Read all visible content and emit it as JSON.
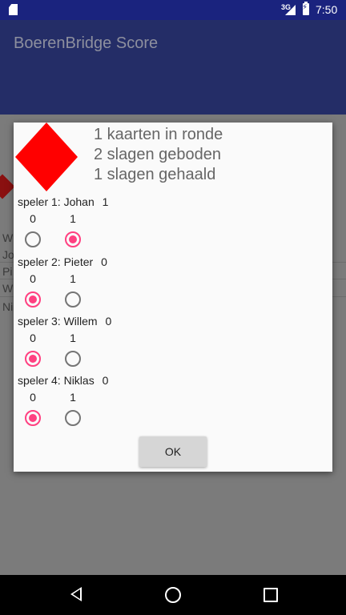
{
  "status_bar": {
    "network": "3G",
    "time": "7:50"
  },
  "app_bar": {
    "title": "BoerenBridge Score"
  },
  "background_rows": [
    "W",
    "Jo",
    "Pi",
    "W",
    "Ni"
  ],
  "dialog": {
    "suit_icon": "diamond-icon",
    "info_lines": [
      "1 kaarten in ronde",
      "2 slagen geboden",
      "1 slagen gehaald"
    ],
    "options": [
      "0",
      "1"
    ],
    "players": [
      {
        "label": "speler 1: Johan",
        "score": "1",
        "selected": "1"
      },
      {
        "label": "speler 2: Pieter",
        "score": "0",
        "selected": "0"
      },
      {
        "label": "speler 3: Willem",
        "score": "0",
        "selected": "0"
      },
      {
        "label": "speler 4: Niklas",
        "score": "0",
        "selected": "0"
      }
    ],
    "ok_label": "OK"
  },
  "colors": {
    "accent": "#ff4081",
    "primary_dark": "#1a237e",
    "suit": "#ff0000"
  }
}
